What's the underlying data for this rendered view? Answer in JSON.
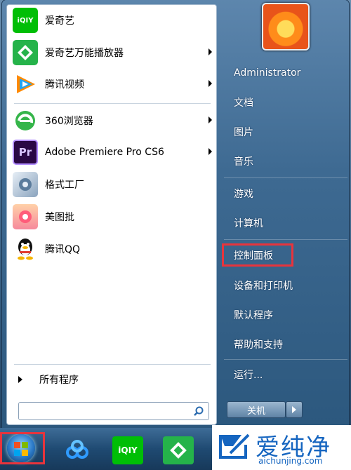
{
  "start_menu": {
    "programs": [
      {
        "label": "爱奇艺",
        "icon": "iqiyi-icon",
        "arrow": false
      },
      {
        "label": "爱奇艺万能播放器",
        "icon": "iqiyi-player-icon",
        "arrow": true
      },
      {
        "label": "腾讯视频",
        "icon": "tencent-video-icon",
        "arrow": true
      },
      {
        "label": "360浏览器",
        "icon": "360-browser-icon",
        "arrow": true
      },
      {
        "label": "Adobe Premiere Pro CS6",
        "icon": "premiere-pro-icon",
        "arrow": true
      },
      {
        "label": "格式工厂",
        "icon": "format-factory-icon",
        "arrow": false
      },
      {
        "label": "美图批",
        "icon": "meitu-batch-icon",
        "arrow": false
      },
      {
        "label": "腾讯QQ",
        "icon": "qq-penguin-icon",
        "arrow": false
      }
    ],
    "all_programs_label": "所有程序",
    "search_placeholder": ""
  },
  "right_pane": {
    "items": [
      {
        "label": "Administrator"
      },
      {
        "label": "文档"
      },
      {
        "label": "图片"
      },
      {
        "label": "音乐"
      },
      {
        "label": "游戏"
      },
      {
        "label": "计算机"
      },
      {
        "label": "控制面板"
      },
      {
        "label": "设备和打印机"
      },
      {
        "label": "默认程序"
      },
      {
        "label": "帮助和支持"
      },
      {
        "label": "运行..."
      }
    ],
    "shutdown_label": "关机"
  },
  "taskbar": {
    "pinned": [
      {
        "icon": "baidu-netdisk-icon"
      },
      {
        "icon": "iqiyi-icon"
      },
      {
        "icon": "iqiyi-player-icon"
      }
    ]
  },
  "watermark": {
    "name": "爱纯净",
    "url": "aichunjing.com"
  },
  "colors": {
    "highlight": "#e8343c",
    "iqiyi_green": "#00be06",
    "premiere_purple": "#2a0845"
  }
}
